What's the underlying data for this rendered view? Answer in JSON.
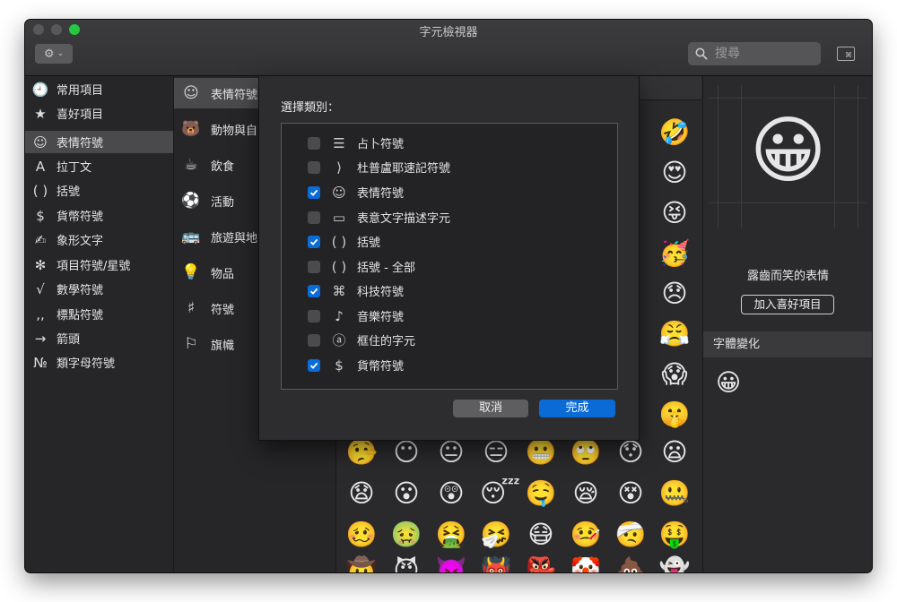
{
  "window": {
    "title": "字元檢視器"
  },
  "toolbar": {
    "search_placeholder": "搜尋",
    "kbd_label": "⌘"
  },
  "sidebar": {
    "items": [
      {
        "icon": "🕘",
        "label": "常用項目"
      },
      {
        "icon": "★",
        "label": "喜好項目"
      },
      {
        "icon": "☺",
        "label": "表情符號"
      },
      {
        "icon": "A",
        "label": "拉丁文"
      },
      {
        "icon": "( )",
        "label": "括號"
      },
      {
        "icon": "$",
        "label": "貨幣符號"
      },
      {
        "icon": "✍",
        "label": "象形文字"
      },
      {
        "icon": "✻",
        "label": "項目符號/星號"
      },
      {
        "icon": "√",
        "label": "數學符號"
      },
      {
        "icon": ",,",
        "label": "標點符號"
      },
      {
        "icon": "→",
        "label": "箭頭"
      },
      {
        "icon": "№",
        "label": "類字母符號"
      }
    ]
  },
  "categories": {
    "items": [
      {
        "icon": "☺",
        "label": "表情符號"
      },
      {
        "icon": "🐻",
        "label": "動物與自"
      },
      {
        "icon": "☕",
        "label": "飲食"
      },
      {
        "icon": "⚽",
        "label": "活動"
      },
      {
        "icon": "🚌",
        "label": "旅遊與地"
      },
      {
        "icon": "💡",
        "label": "物品"
      },
      {
        "icon": "♯",
        "label": "符號"
      },
      {
        "icon": "⚐",
        "label": "旗幟"
      }
    ]
  },
  "grid": {
    "right_column": [
      "🤣",
      "😍",
      "😝",
      "🥳",
      "😞",
      "😤",
      "😱",
      "🤫"
    ],
    "rows": [
      [
        "🤥",
        "😶",
        "😐",
        "😑",
        "😬",
        "🙄",
        "😯",
        "😦"
      ],
      [
        "😧",
        "😮",
        "😲",
        "😴",
        "🤤",
        "😪",
        "😵",
        "🤐"
      ],
      [
        "🥴",
        "🤢",
        "🤮",
        "🤧",
        "😷",
        "🤒",
        "🤕",
        "🤑"
      ],
      [
        "🤠",
        "😈",
        "👿",
        "👹",
        "👺",
        "🤡",
        "💩",
        "👻"
      ]
    ]
  },
  "detail": {
    "emoji": "😀",
    "name": "露齒而笑的表情",
    "fav_button": "加入喜好項目",
    "variants_header": "字體變化",
    "variants": [
      "😀"
    ]
  },
  "sheet": {
    "title": "選擇類別：",
    "rows": [
      {
        "icon": "☰",
        "label": "占卜符號",
        "checked": false
      },
      {
        "icon": "⟩",
        "label": "杜普盧耶速記符號",
        "checked": false
      },
      {
        "icon": "☺",
        "label": "表情符號",
        "checked": true
      },
      {
        "icon": "▭",
        "label": "表意文字描述字元",
        "checked": false
      },
      {
        "icon": "( )",
        "label": "括號",
        "checked": true
      },
      {
        "icon": "( )",
        "label": "括號 - 全部",
        "checked": false
      },
      {
        "icon": "⌘",
        "label": "科技符號",
        "checked": true
      },
      {
        "icon": "♪",
        "label": "音樂符號",
        "checked": false
      },
      {
        "icon": "ⓐ",
        "label": "框住的字元",
        "checked": false
      },
      {
        "icon": "$",
        "label": "貨幣符號",
        "checked": true
      }
    ],
    "cancel": "取消",
    "done": "完成"
  },
  "colors": {
    "accent": "#0b6bd6",
    "window_bg": "#2a2a2c",
    "selection": "#4a4a4c"
  }
}
